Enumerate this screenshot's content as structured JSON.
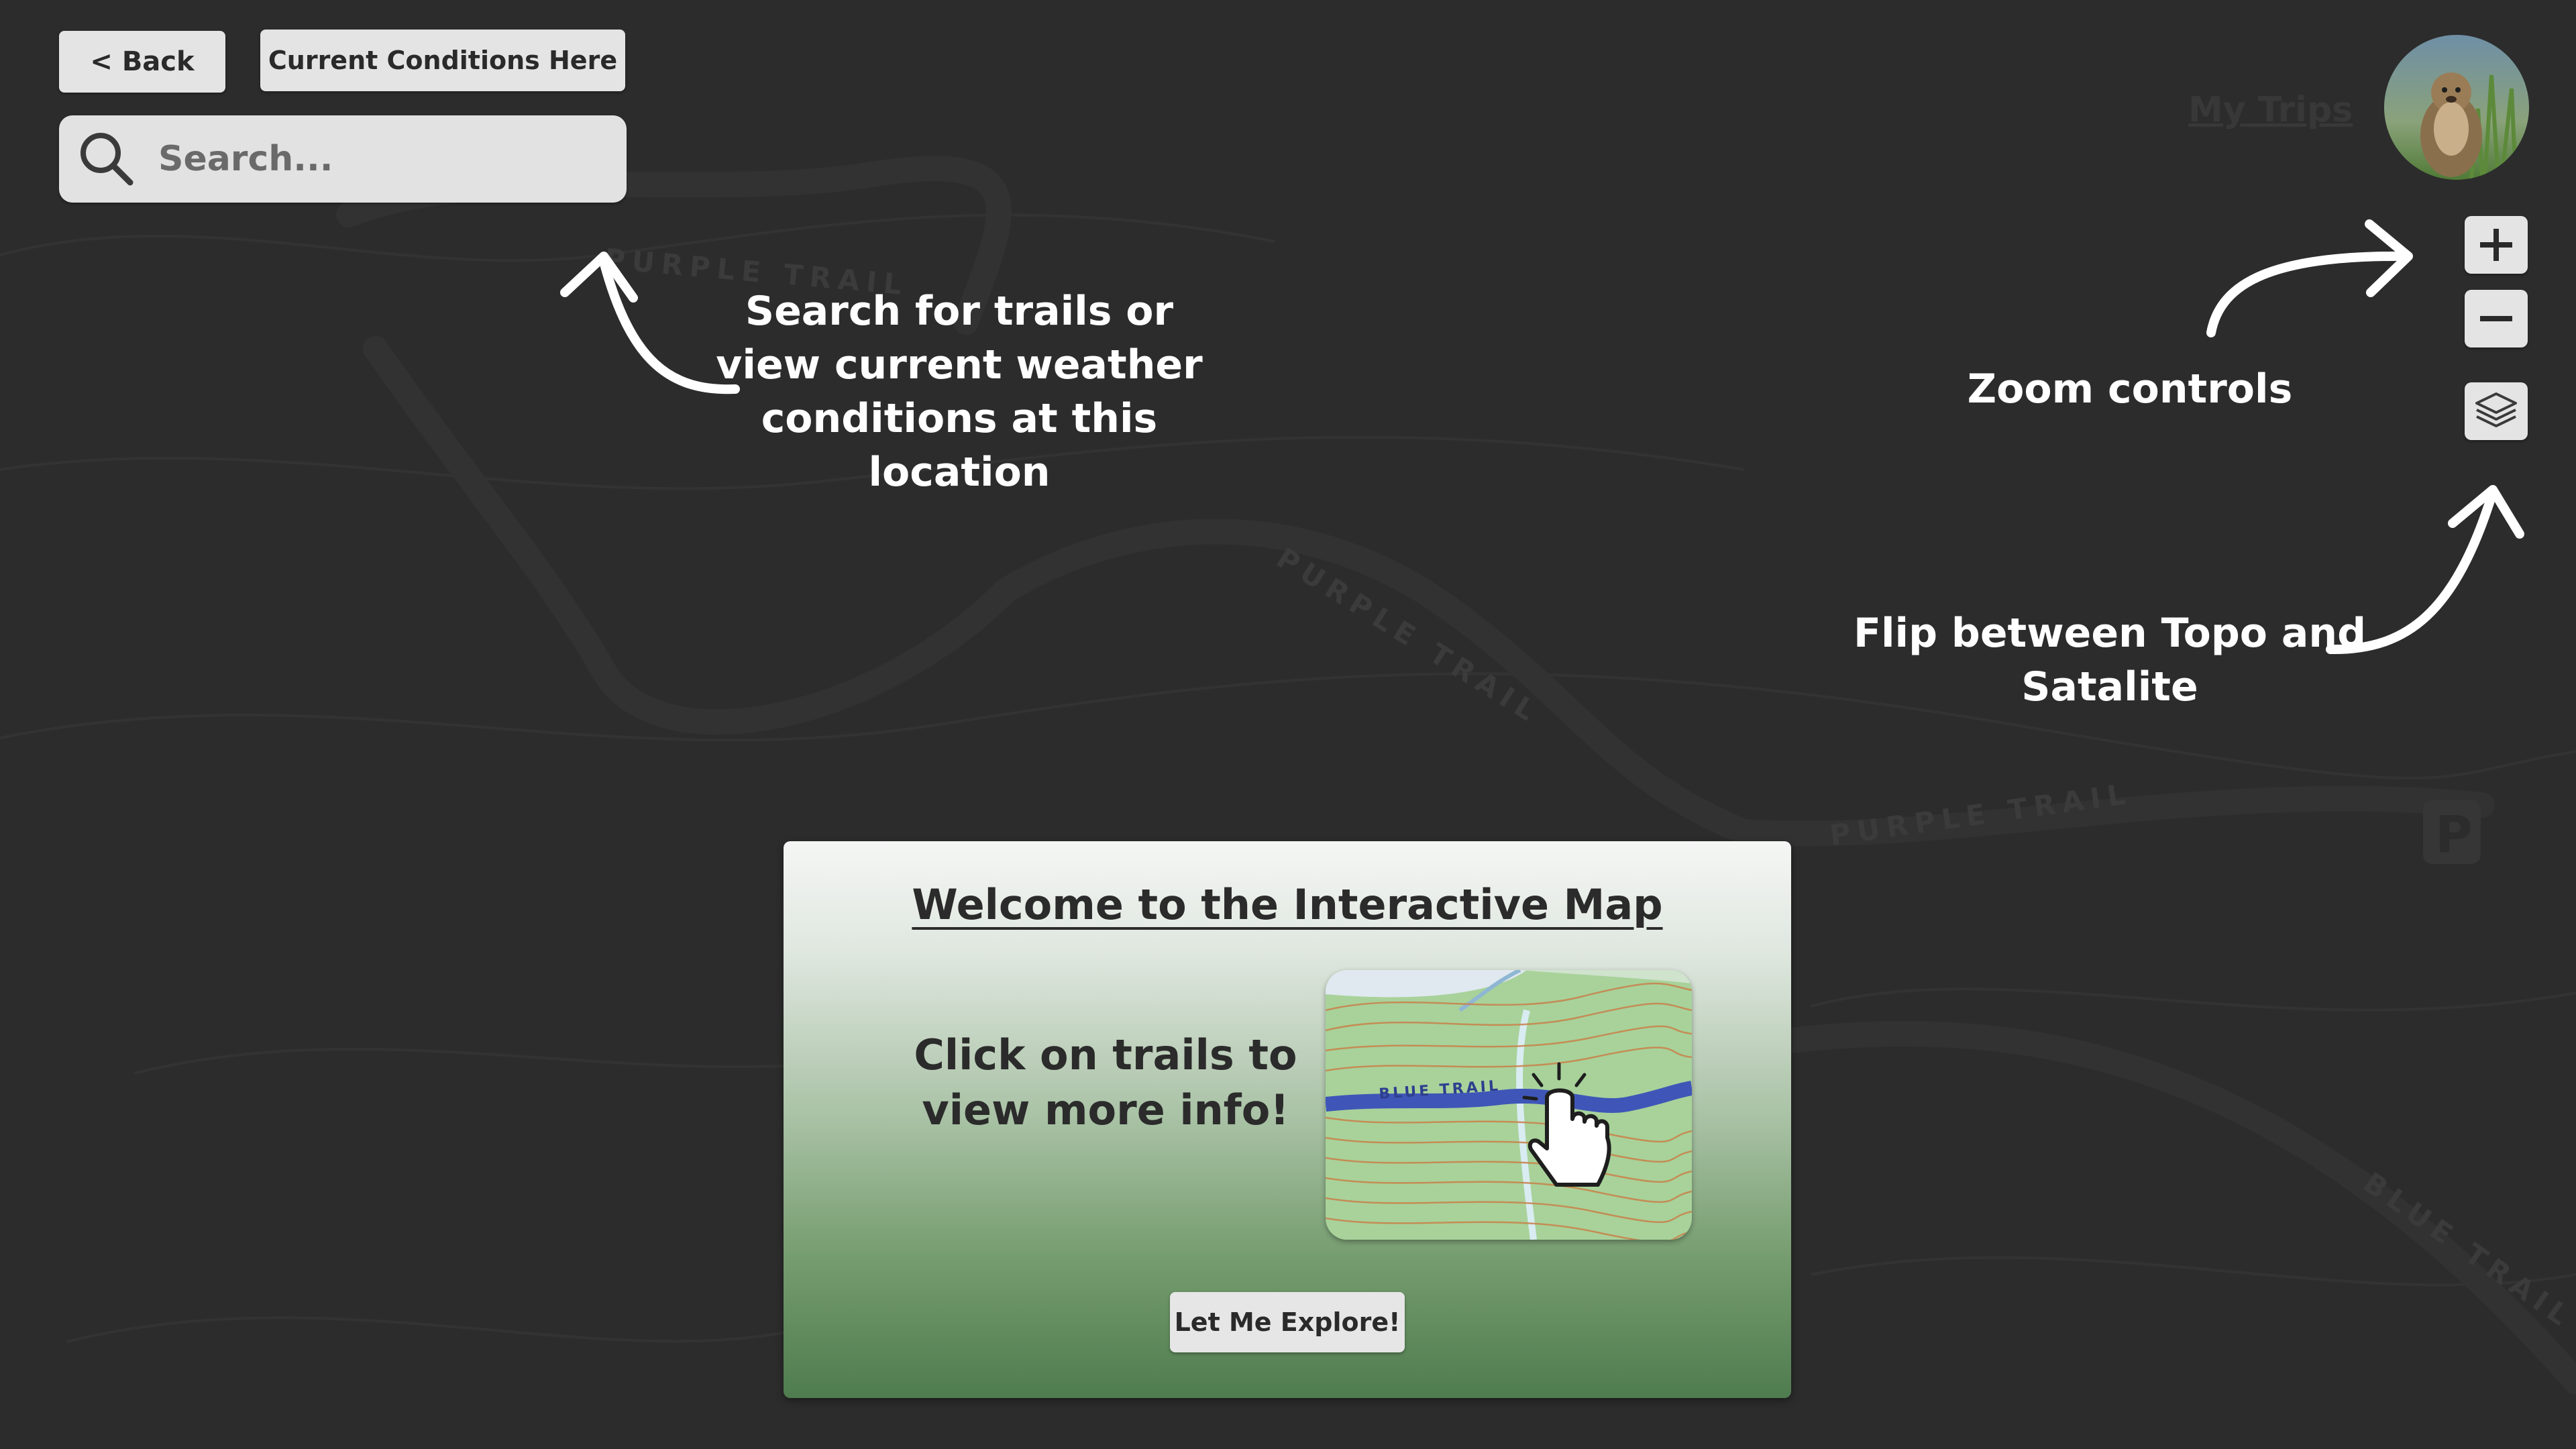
{
  "toolbar": {
    "back_label": "< Back",
    "conditions_label": "Current Conditions Here"
  },
  "search": {
    "placeholder": "Search...",
    "value": ""
  },
  "header": {
    "my_trips_label": "My Trips"
  },
  "map": {
    "trail_labels": [
      "PURPLE TRAIL",
      "PURPLE TRAIL",
      "PURPLE TRAIL",
      "BLUE TRAIL"
    ],
    "parking_icon": "parking-icon"
  },
  "annotations": {
    "search": "Search for trails or view current weather conditions at this location",
    "zoom": "Zoom controls",
    "layers": "Flip between Topo and Satalite"
  },
  "modal": {
    "title": "Welcome to the Interactive Map",
    "instruction": "Click on trails to view more info!",
    "preview_trail_label": "BLUE TRAIL",
    "button_label": "Let Me Explore!"
  },
  "icons": {
    "search": "search-icon",
    "zoom_in": "plus-icon",
    "zoom_out": "minus-icon",
    "layers": "layers-icon",
    "cursor": "pointer-hand-icon"
  },
  "colors": {
    "background": "#2c2c2c",
    "button": "#e4e4e4",
    "annotation_text": "#ffffff",
    "modal_top": "#f5f6f5",
    "modal_bottom": "#4f7c4f",
    "trail_blue": "#3f56b8"
  }
}
